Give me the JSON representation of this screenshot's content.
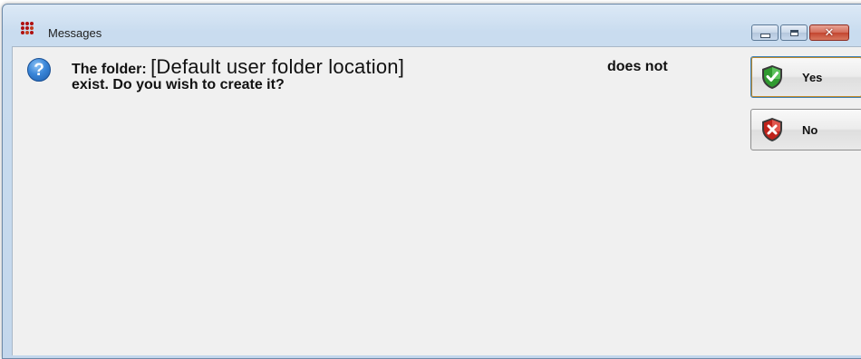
{
  "window": {
    "title": "Messages"
  },
  "caption": {
    "minimize": "minimize-icon",
    "maximize": "maximize-icon",
    "close_glyph": "✕"
  },
  "dialog": {
    "icon": "question-icon",
    "icon_glyph": "?",
    "message_prefix": "The folder: ",
    "message_placeholder": "[Default user folder location]",
    "message_tail": "does not",
    "message_line2": "exist. Do you wish to create it?"
  },
  "buttons": {
    "yes_label": "Yes",
    "no_label": "No"
  },
  "colors": {
    "yes_shield": "#2f9a2f",
    "no_shield": "#c0221a",
    "shield_rim": "#4a4a4a"
  }
}
